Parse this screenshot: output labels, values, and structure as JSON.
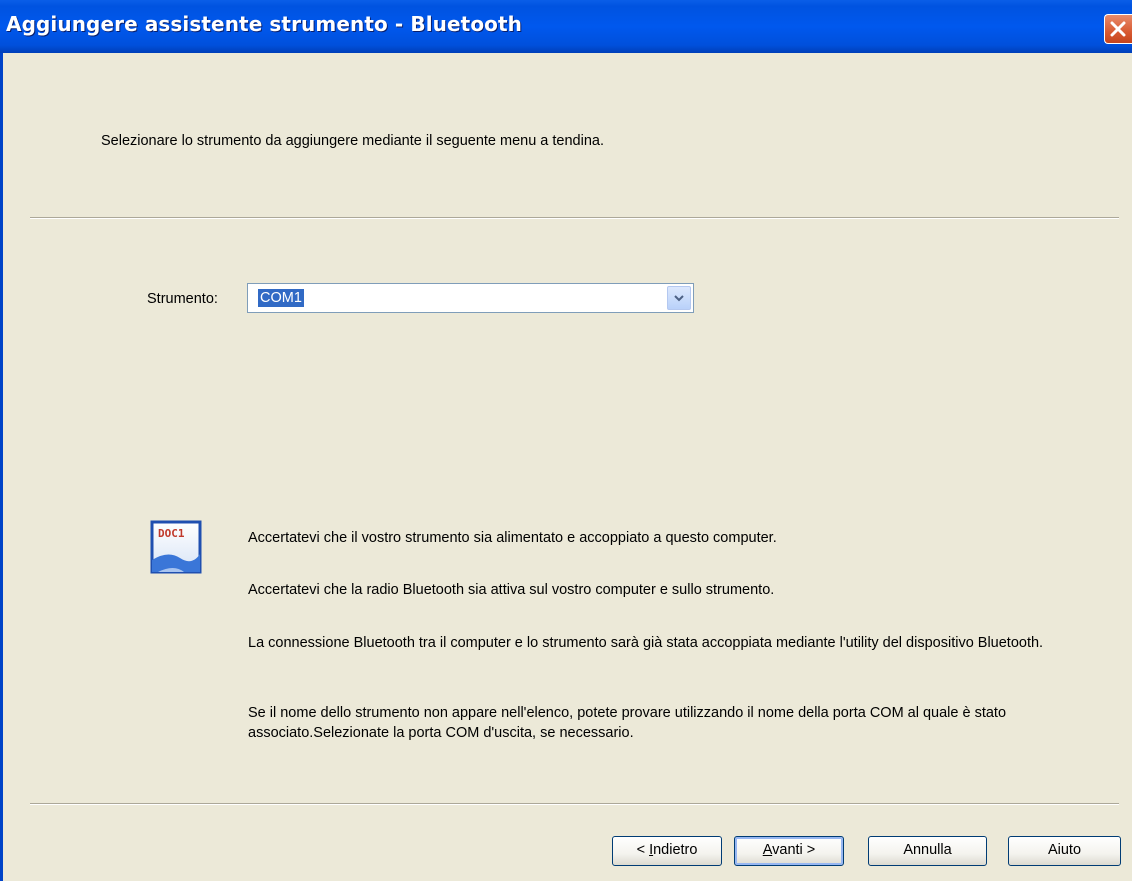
{
  "window": {
    "title": "Aggiungere assistente strumento - Bluetooth",
    "close_icon": "close-icon"
  },
  "instruction": "Selezionare lo strumento da aggiungere mediante il seguente menu a tendina.",
  "instrument": {
    "label": "Strumento:",
    "selected": "COM1"
  },
  "info": {
    "icon": "document-icon",
    "icon_text": "DOC1",
    "messages": [
      "Accertatevi che il vostro strumento sia alimentato e  accoppiato a questo computer.",
      "Accertatevi  che la radio Bluetooth sia attiva sul vostro computer e sullo strumento.",
      "La connessione Bluetooth tra il computer e lo strumento sarà già stata accoppiata  mediante l'utility del dispositivo Bluetooth.",
      "Se il nome dello strumento non appare nell'elenco, potete provare utilizzando il nome della porta COM al quale è stato associato.Selezionate la porta COM d'uscita, se necessario."
    ]
  },
  "buttons": {
    "back": "< Indietro",
    "next": "Avanti >",
    "cancel": "Annulla",
    "help": "Aiuto"
  },
  "colors": {
    "titlebar": "#0054e3",
    "dialog_bg": "#ece9d8",
    "selection": "#316ac5"
  }
}
